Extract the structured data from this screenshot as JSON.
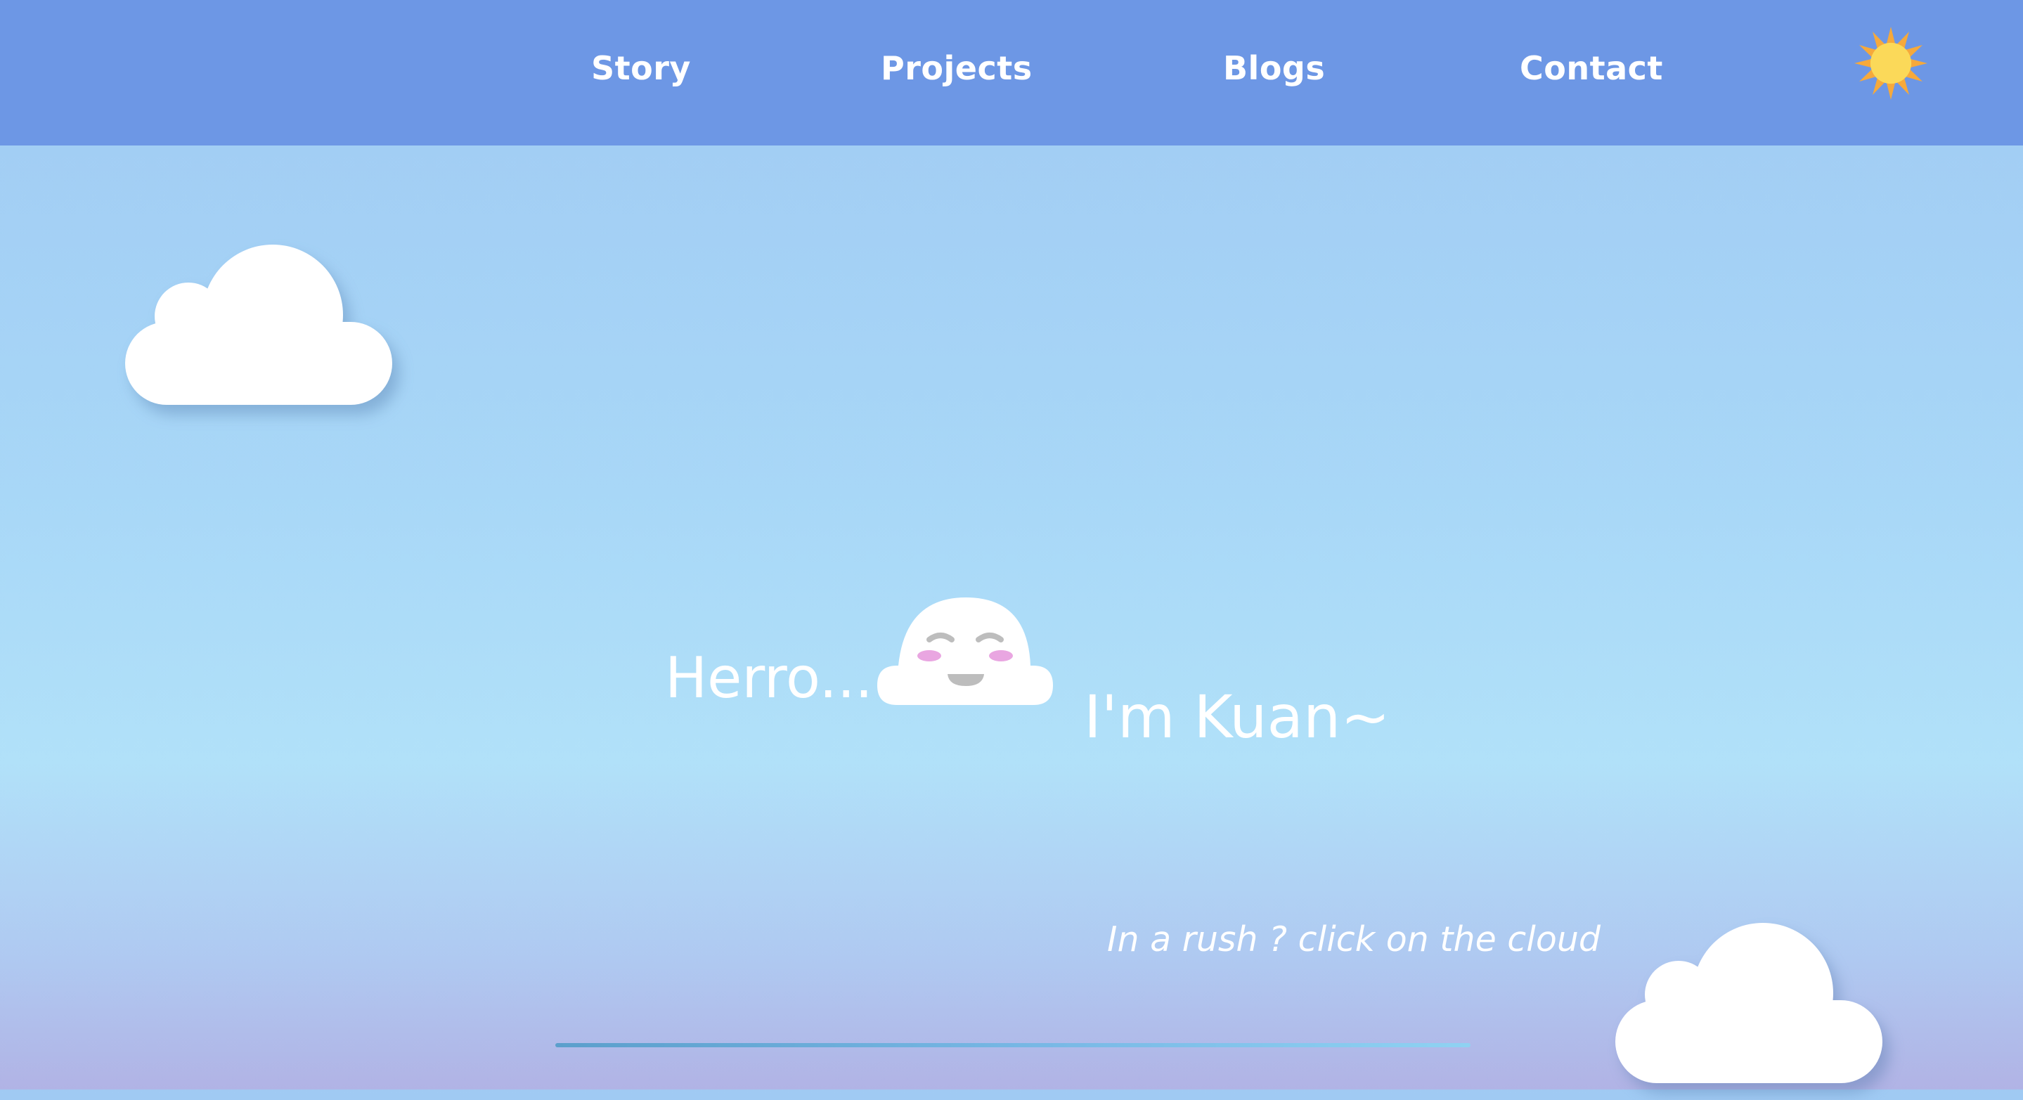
{
  "nav": {
    "items": [
      {
        "label": "Story"
      },
      {
        "label": "Projects"
      },
      {
        "label": "Blogs"
      },
      {
        "label": "Contact"
      }
    ],
    "theme_toggle_icon": "sun-icon"
  },
  "hero": {
    "greeting": "Herro...",
    "name_line": "I'm Kuan~",
    "mascot_icon": "smiling-cloud-icon",
    "hint": "In a rush ? click on the cloud"
  },
  "colors": {
    "nav_background": "#6d97e5",
    "sky_top": "#a0caf3",
    "sky_mid": "#b1e1f9",
    "sky_bottom": "#b1b3e5",
    "sun_outer": "#f6a93b",
    "sun_inner": "#fbd959",
    "cloud": "#ffffff",
    "blush": "#e9a6e1",
    "face_features": "#bdbdbd",
    "progress_line": "#5b9fcc"
  }
}
